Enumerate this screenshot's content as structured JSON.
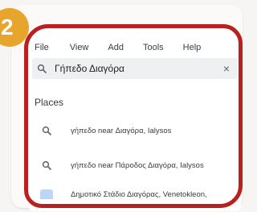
{
  "step_badge": "2",
  "menu": {
    "items": [
      "File",
      "View",
      "Add",
      "Tools",
      "Help"
    ]
  },
  "search": {
    "value": "Γήπεδο Διαγόρα",
    "clear_glyph": "×",
    "icon": "search-icon"
  },
  "places": {
    "title": "Places",
    "items": [
      {
        "label": "γήπεδο near Διαγόρα, Ialysos",
        "icon": "search-icon"
      },
      {
        "label": "γήπεδο near Πάροδος Διαγόρα, Ialysos",
        "icon": "search-icon"
      },
      {
        "label": "Δημοτικό Στάδιο Διαγόρας, Venetokleon,",
        "icon": "location-icon"
      }
    ]
  },
  "colors": {
    "badge": "#e8a52c",
    "highlight_outline": "#b8211f",
    "search_bg": "#eef0f2"
  }
}
